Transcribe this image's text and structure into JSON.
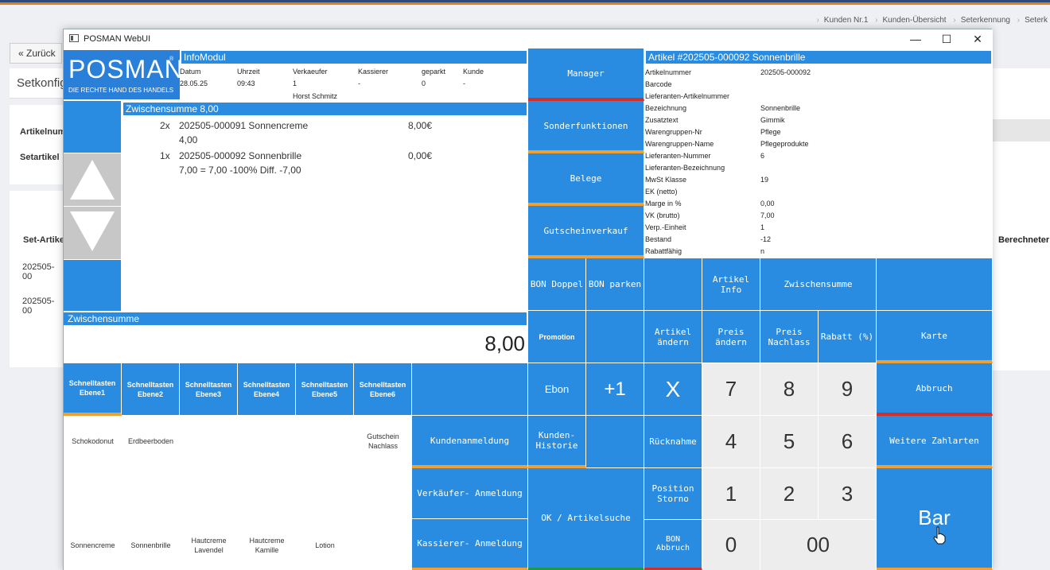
{
  "breadcrumb": [
    "Kunden Nr.1",
    "Kunden-Übersicht",
    "Seterkennung",
    "Seterk"
  ],
  "background": {
    "back_label": "« Zurück",
    "page_title": "Setkonfig",
    "label_artikelnummer": "Artikelnum",
    "label_setartikel": "Setartikel",
    "table_header": "Set-Artike",
    "row1": "202505-00",
    "row2": "202505-00",
    "right_header": "Berechneter"
  },
  "window": {
    "title": "POSMAN WebUI",
    "minimize": "—",
    "maximize": "☐",
    "close": "✕"
  },
  "logo": {
    "name": "POSMAN",
    "trademark": "®",
    "tagline": "DIE RECHTE HAND DES HANDELS"
  },
  "infomodul": {
    "header": "InfoModul",
    "columns": [
      "Datum",
      "Uhrzeit",
      "Verkaeufer",
      "Kassierer",
      "geparkt",
      "Kunde"
    ],
    "values": [
      "28.05.25",
      "09:43",
      "1",
      "-",
      "0",
      "-"
    ],
    "seller_name": "Horst Schmitz"
  },
  "cart": {
    "header": "Zwischensumme 8,00",
    "lines": [
      {
        "qty": "2x",
        "desc": "202505-000091 Sonnencreme",
        "price": "8,00€",
        "detail": "4,00"
      },
      {
        "qty": "1x",
        "desc": "202505-000092 Sonnenbrille",
        "price": "0,00€",
        "detail": "7,00 = 7,00 -100% Diff. -7,00"
      }
    ]
  },
  "subtotal": {
    "label": "Zwischensumme",
    "value": "8,00"
  },
  "shortcut_tabs": [
    {
      "line1": "Schnelltasten",
      "line2": "Ebene1"
    },
    {
      "line1": "Schnelltasten",
      "line2": "Ebene2"
    },
    {
      "line1": "Schnelltasten",
      "line2": "Ebene3"
    },
    {
      "line1": "Schnelltasten",
      "line2": "Ebene4"
    },
    {
      "line1": "Schnelltasten",
      "line2": "Ebene5"
    },
    {
      "line1": "Schnelltasten",
      "line2": "Ebene6"
    }
  ],
  "shortcuts": {
    "schokodonut": "Schokodonut",
    "erdbeerboden": "Erdbeerboden",
    "gutschein1": "Gutschein",
    "gutschein2": "Nachlass",
    "sonnencreme": "Sonnencreme",
    "sonnenbrille": "Sonnenbrille",
    "hautcreme_lav1": "Hautcreme",
    "hautcreme_lav2": "Lavendel",
    "hautcreme_kam1": "Hautcreme",
    "hautcreme_kam2": "Kamille",
    "lotion": "Lotion"
  },
  "functions": {
    "manager": "Manager",
    "sonderfunktionen": "Sonderfunktionen",
    "belege": "Belege",
    "gutscheinverkauf": "Gutscheinverkauf",
    "bon_doppel": "BON Doppel",
    "bon_parken": "BON parken",
    "artikel_info1": "Artikel",
    "artikel_info2": "Info",
    "zwischensumme": "Zwischensumme",
    "promotion": "Promotion",
    "artikel_aendern1": "Artikel",
    "artikel_aendern2": "ändern",
    "preis_aendern1": "Preis",
    "preis_aendern2": "ändern",
    "preis_nachlass1": "Preis",
    "preis_nachlass2": "Nachlass",
    "rabatt": "Rabatt (%)",
    "karte": "Karte",
    "ebon": "Ebon",
    "plus_one": "+1",
    "times": "X",
    "abbruch": "Abbruch",
    "kundenanmeldung": "Kundenanmeldung",
    "kunden_historie1": "Kunden-",
    "kunden_historie2": "Historie",
    "ruecknahme": "Rücknahme",
    "weitere_zahlarten": "Weitere Zahlarten",
    "verkaeufer_anmeldung": "Verkäufer- Anmeldung",
    "ok_artikelsuche": "OK / Artikelsuche",
    "position_storno1": "Position",
    "position_storno2": "Storno",
    "kassierer_anmeldung": "Kassierer- Anmeldung",
    "bon_abbruch1": "BON",
    "bon_abbruch2": "Abbruch",
    "bar": "Bar"
  },
  "keypad": {
    "k7": "7",
    "k8": "8",
    "k9": "9",
    "k4": "4",
    "k5": "5",
    "k6": "6",
    "k1": "1",
    "k2": "2",
    "k3": "3",
    "k0": "0",
    "k00": "00"
  },
  "article": {
    "header": "Artikel #202505-000092 Sonnenbrille",
    "fields": [
      {
        "k": "Artikelnummer",
        "v": "202505-000092"
      },
      {
        "k": "Barcode",
        "v": ""
      },
      {
        "k": "Lieferanten-Artikelnummer",
        "v": ""
      },
      {
        "k": "Bezeichnung",
        "v": "Sonnenbrille"
      },
      {
        "k": "Zusatztext",
        "v": "Gimmik"
      },
      {
        "k": "Warengruppen-Nr",
        "v": "Pflege"
      },
      {
        "k": "Warengruppen-Name",
        "v": "Pflegeprodukte"
      },
      {
        "k": "Lieferanten-Nummer",
        "v": "6"
      },
      {
        "k": "Lieferanten-Bezeichnung",
        "v": ""
      },
      {
        "k": "MwSt Klasse",
        "v": "19"
      },
      {
        "k": "EK (netto)",
        "v": ""
      },
      {
        "k": "Marge in %",
        "v": "0,00"
      },
      {
        "k": "VK (brutto)",
        "v": "7,00"
      },
      {
        "k": "Verp.-Einheit",
        "v": "1"
      },
      {
        "k": "Bestand",
        "v": "-12"
      },
      {
        "k": "Rabattfähig",
        "v": "n"
      }
    ]
  },
  "colors": {
    "accent": "#2a8ce0",
    "orange": "#f0a030",
    "red": "#d0302a",
    "green": "#1a9a4a"
  }
}
